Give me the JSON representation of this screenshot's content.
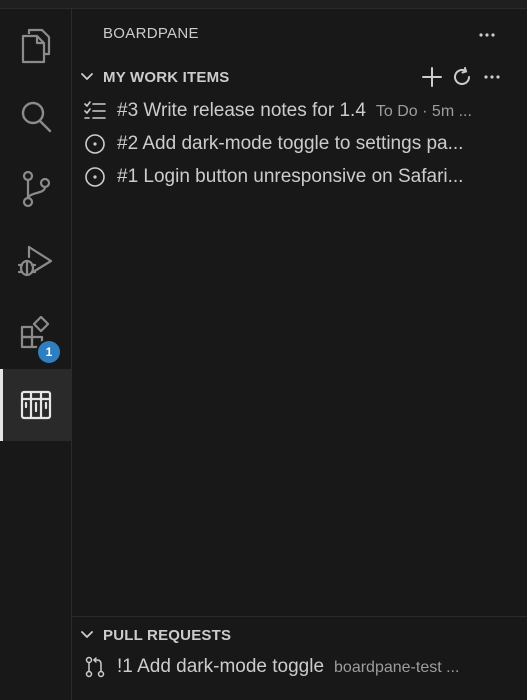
{
  "sidebar": {
    "title": "BOARDPANE",
    "more_label": "···"
  },
  "activity_bar": {
    "items": [
      {
        "icon": "files-icon"
      },
      {
        "icon": "search-icon"
      },
      {
        "icon": "source-control-icon"
      },
      {
        "icon": "run-debug-icon"
      },
      {
        "icon": "extensions-icon",
        "badge": "1"
      },
      {
        "icon": "boardpane-icon",
        "active": true
      }
    ]
  },
  "work_items": {
    "title": "MY WORK ITEMS",
    "more_label": "···",
    "items": [
      {
        "icon": "checklist-icon",
        "label": "#3 Write release notes for 1.4",
        "description": "To Do · 5m ..."
      },
      {
        "icon": "circle-icon",
        "label": "#2 Add dark-mode toggle to settings pa...",
        "description": ""
      },
      {
        "icon": "circle-icon",
        "label": "#1 Login button unresponsive on Safari...",
        "description": ""
      }
    ]
  },
  "pull_requests": {
    "title": "PULL REQUESTS",
    "items": [
      {
        "icon": "pull-request-icon",
        "label": "!1 Add dark-mode toggle",
        "description": "boardpane-test ..."
      }
    ]
  },
  "colors": {
    "background": "#181818",
    "border": "#2b2b2b",
    "text": "#cccccc",
    "muted": "#9d9d9d",
    "badge": "#2f7ebf"
  }
}
